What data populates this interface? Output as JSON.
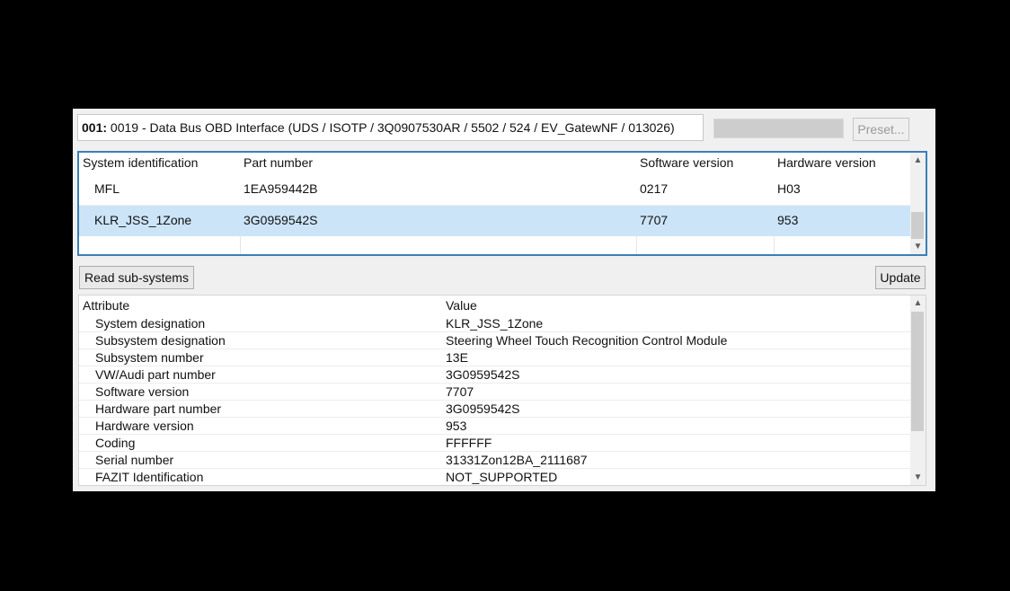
{
  "header": {
    "module_number": "001:",
    "module_title": " 0019 - Data Bus OBD Interface  (UDS / ISOTP / 3Q0907530AR / 5502 / 524 / EV_GatewNF / 013026)"
  },
  "toolbar": {
    "preset_label": "Preset..."
  },
  "subsystems_table": {
    "columns": [
      "System identification",
      "Part number",
      "Software version",
      "Hardware version"
    ],
    "rows": [
      {
        "system": "MFL",
        "part_number": "1EA959442B",
        "software": "0217",
        "hardware": "H03",
        "selected": false
      },
      {
        "system": "KLR_JSS_1Zone",
        "part_number": "3G0959542S",
        "software": "7707",
        "hardware": "953",
        "selected": true
      }
    ]
  },
  "actions": {
    "read_subsystems_label": "Read sub-systems",
    "update_label": "Update"
  },
  "attributes_table": {
    "columns": [
      "Attribute",
      "Value"
    ],
    "rows": [
      {
        "attribute": "System designation",
        "value": "KLR_JSS_1Zone"
      },
      {
        "attribute": "Subsystem designation",
        "value": "Steering Wheel Touch Recognition Control Module"
      },
      {
        "attribute": "Subsystem number",
        "value": "13E"
      },
      {
        "attribute": "VW/Audi part number",
        "value": "3G0959542S"
      },
      {
        "attribute": "Software version",
        "value": "7707"
      },
      {
        "attribute": "Hardware part number",
        "value": "3G0959542S"
      },
      {
        "attribute": "Hardware version",
        "value": "953"
      },
      {
        "attribute": "Coding",
        "value": "FFFFFF"
      },
      {
        "attribute": "Serial number",
        "value": "31331Zon12BA_2111687"
      },
      {
        "attribute": "FAZIT Identification",
        "value": "NOT_SUPPORTED"
      }
    ]
  },
  "icons": {
    "scroll_up": "scroll-up-arrow-icon",
    "scroll_down": "scroll-down-arrow-icon"
  },
  "colors": {
    "selection": "#cce4f7",
    "focus_border": "#3b7fb6"
  }
}
